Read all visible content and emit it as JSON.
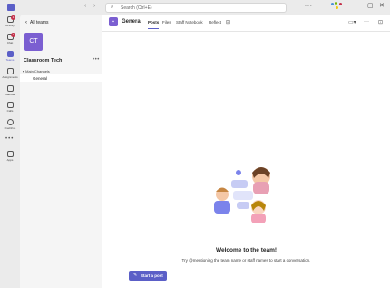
{
  "titlebar": {
    "search_placeholder": "Search (Ctrl+E)",
    "more": "...",
    "back": "‹",
    "forward": "›",
    "minimize": "—",
    "maximize": "▢",
    "close": "✕"
  },
  "rail": {
    "items": [
      {
        "label": "Activity",
        "badge": "1"
      },
      {
        "label": "Chat",
        "badge": "1"
      },
      {
        "label": "Teams",
        "badge": ""
      },
      {
        "label": "Assignments",
        "badge": ""
      },
      {
        "label": "Calendar",
        "badge": ""
      },
      {
        "label": "Calls",
        "badge": ""
      },
      {
        "label": "OneDrive",
        "badge": ""
      }
    ],
    "more": "•••",
    "apps_label": "Apps"
  },
  "panel": {
    "back_label": "All teams",
    "team_initials": "CT",
    "team_name": "Classroom Tech",
    "team_more": "•••",
    "group_label": "Main Channels",
    "channel": "General"
  },
  "header": {
    "channel_title": "General",
    "tabs": [
      "Posts",
      "Files",
      "Staff Notebook",
      "Reflect"
    ],
    "add_tab": "⊟"
  },
  "empty_state": {
    "title": "Welcome to the team!",
    "hint": "Try @mentioning the team name or staff names to start a conversation."
  },
  "compose": {
    "button_label": "Start a post"
  },
  "colors": {
    "accent": "#5b5fc7",
    "team": "#7b5fd1",
    "badge": "#c4314b"
  }
}
